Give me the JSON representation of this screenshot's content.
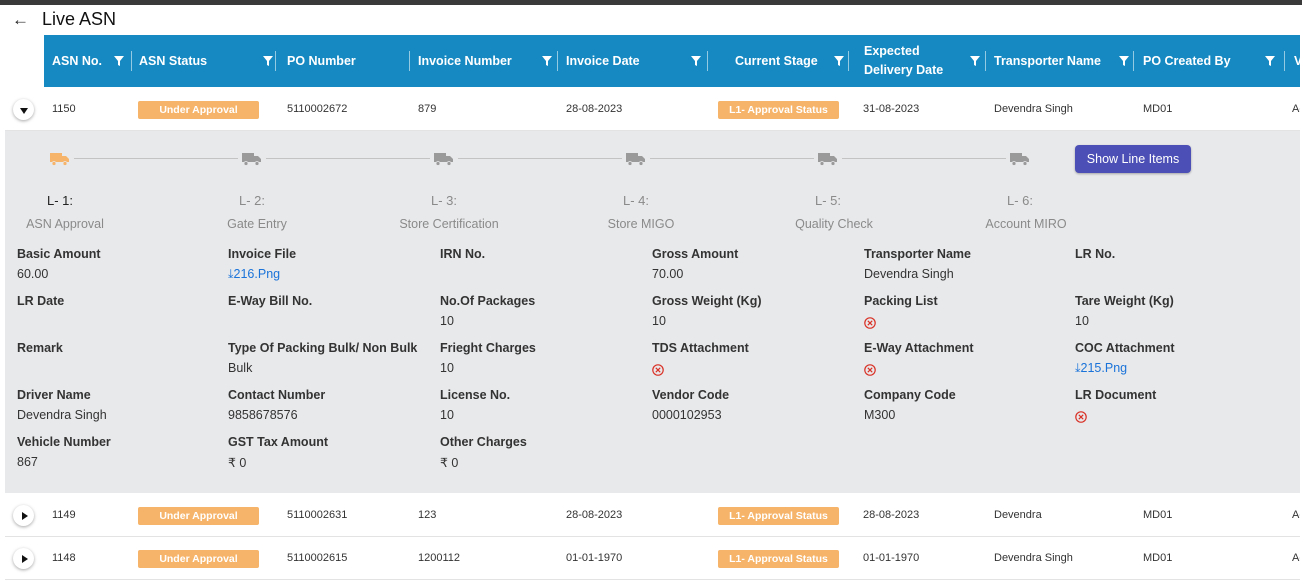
{
  "page": {
    "title": "Live ASN"
  },
  "table": {
    "columns": [
      {
        "label": "ASN No."
      },
      {
        "label": "ASN Status"
      },
      {
        "label": "PO Number"
      },
      {
        "label": "Invoice Number"
      },
      {
        "label": "Invoice Date"
      },
      {
        "label": "Current Stage"
      },
      {
        "label": "Expected Delivery Date"
      },
      {
        "label": "Transporter Name"
      },
      {
        "label": "PO Created By"
      },
      {
        "label": "Ve"
      }
    ],
    "rows": [
      {
        "asn_no": "1150",
        "status": "Under Approval",
        "po_number": "5110002672",
        "invoice_number": "879",
        "invoice_date": "28-08-2023",
        "stage": "L1- Approval Status",
        "delivery_date": "31-08-2023",
        "transporter": "Devendra Singh",
        "created_by": "MD01",
        "cut": "Ac",
        "expanded": true
      },
      {
        "asn_no": "1149",
        "status": "Under Approval",
        "po_number": "5110002631",
        "invoice_number": "123",
        "invoice_date": "28-08-2023",
        "stage": "L1- Approval Status",
        "delivery_date": "28-08-2023",
        "transporter": "Devendra",
        "created_by": "MD01",
        "cut": "Ac",
        "expanded": false
      },
      {
        "asn_no": "1148",
        "status": "Under Approval",
        "po_number": "5110002615",
        "invoice_number": "1200112",
        "invoice_date": "01-01-1970",
        "stage": "L1- Approval Status",
        "delivery_date": "01-01-1970",
        "transporter": "Devendra Singh",
        "created_by": "MD01",
        "cut": "Ac",
        "expanded": false
      }
    ]
  },
  "detail": {
    "show_line_items_label": "Show Line Items",
    "stages": [
      {
        "code": "L- 1:",
        "name": "ASN Approval",
        "active": true
      },
      {
        "code": "L- 2:",
        "name": "Gate Entry",
        "active": false
      },
      {
        "code": "L- 3:",
        "name": "Store Certification",
        "active": false
      },
      {
        "code": "L- 4:",
        "name": "Store MIGO",
        "active": false
      },
      {
        "code": "L- 5:",
        "name": "Quality Check",
        "active": false
      },
      {
        "code": "L- 6:",
        "name": "Account MIRO",
        "active": false
      }
    ],
    "fields": [
      {
        "label": "Basic Amount",
        "value": "60.00",
        "kind": "text"
      },
      {
        "label": "Invoice File",
        "value": "216.Png",
        "kind": "link"
      },
      {
        "label": "IRN No.",
        "value": "",
        "kind": "text"
      },
      {
        "label": "Gross Amount",
        "value": "70.00",
        "kind": "text"
      },
      {
        "label": "Transporter Name",
        "value": "Devendra Singh",
        "kind": "text"
      },
      {
        "label": "LR No.",
        "value": "",
        "kind": "text"
      },
      {
        "label": "LR Date",
        "value": "",
        "kind": "text"
      },
      {
        "label": "E-Way Bill No.",
        "value": "",
        "kind": "text"
      },
      {
        "label": "No.Of Packages",
        "value": "10",
        "kind": "text"
      },
      {
        "label": "Gross Weight (Kg)",
        "value": "10",
        "kind": "text"
      },
      {
        "label": "Packing List",
        "value": "",
        "kind": "missing"
      },
      {
        "label": "Tare Weight (Kg)",
        "value": "10",
        "kind": "text"
      },
      {
        "label": "Remark",
        "value": "",
        "kind": "text"
      },
      {
        "label": "Type Of Packing Bulk/ Non Bulk",
        "value": "Bulk",
        "kind": "text"
      },
      {
        "label": "Frieght Charges",
        "value": "10",
        "kind": "text"
      },
      {
        "label": "TDS Attachment",
        "value": "",
        "kind": "missing"
      },
      {
        "label": "E-Way Attachment",
        "value": "",
        "kind": "missing"
      },
      {
        "label": "COC Attachment",
        "value": "215.Png",
        "kind": "link"
      },
      {
        "label": "Driver Name",
        "value": "Devendra Singh",
        "kind": "text"
      },
      {
        "label": "Contact Number",
        "value": "9858678576",
        "kind": "text"
      },
      {
        "label": "License No.",
        "value": "10",
        "kind": "text"
      },
      {
        "label": "Vendor Code",
        "value": "0000102953",
        "kind": "text"
      },
      {
        "label": "Company Code",
        "value": "M300",
        "kind": "text"
      },
      {
        "label": "LR Document",
        "value": "",
        "kind": "missing"
      },
      {
        "label": "Vehicle Number",
        "value": "867",
        "kind": "text"
      },
      {
        "label": "GST Tax Amount",
        "value": "₹ 0",
        "kind": "text"
      },
      {
        "label": "Other Charges",
        "value": "₹ 0",
        "kind": "text"
      }
    ]
  },
  "colors": {
    "header_bg": "#1689c2",
    "badge_bg": "#f6b46a",
    "button_bg": "#4c4fb5",
    "link": "#1a73d9",
    "error": "#d93025",
    "truck_active": "#f6b46a",
    "truck_inactive": "#9a9a9a"
  }
}
